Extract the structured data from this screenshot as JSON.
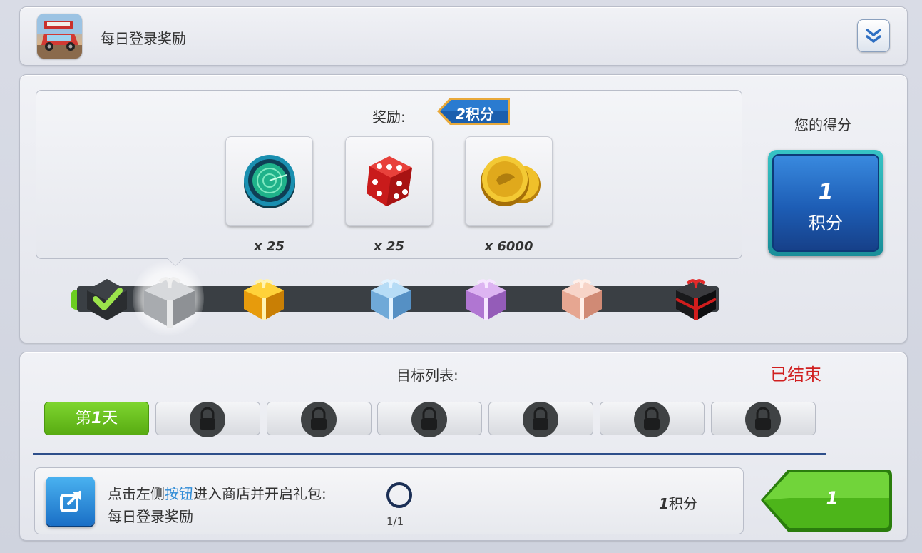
{
  "header": {
    "title": "每日登录奖励",
    "app_icon": "truck-game-icon",
    "collapse_icon": "double-chevron-down-icon"
  },
  "rewards": {
    "label": "奖励:",
    "points_tag_num": "2",
    "points_tag_unit": "积分",
    "items": [
      {
        "icon": "radar-icon",
        "qty": "x 25"
      },
      {
        "icon": "dice-icon",
        "qty": "x 25"
      },
      {
        "icon": "gold-coins-icon",
        "qty": "x 6000"
      }
    ],
    "gifts": [
      "checkmark-gift-icon",
      "silver-gift-icon",
      "gold-gift-icon",
      "blue-gift-icon",
      "purple-gift-icon",
      "pink-gift-icon",
      "black-gift-icon"
    ]
  },
  "score": {
    "label": "您的得分",
    "value": "1",
    "unit": "积分"
  },
  "goals": {
    "label": "目标列表:",
    "status": "已结束",
    "day_prefix": "第",
    "day_num": "1",
    "day_suffix": "天",
    "locked_days": 6
  },
  "task": {
    "line1_a": "点击左侧",
    "line1_highlight": "按钮",
    "line1_b": "进入商店并开启礼包:",
    "line2": "每日登录奖励",
    "progress": "1/1",
    "points_num": "1",
    "points_unit": "积分",
    "claim_value": "1"
  },
  "colors": {
    "accent_green": "#6ccd21",
    "ended_red": "#d01f1f",
    "score_blue": "#1d5db5",
    "highlight_blue": "#2e8bd6"
  }
}
